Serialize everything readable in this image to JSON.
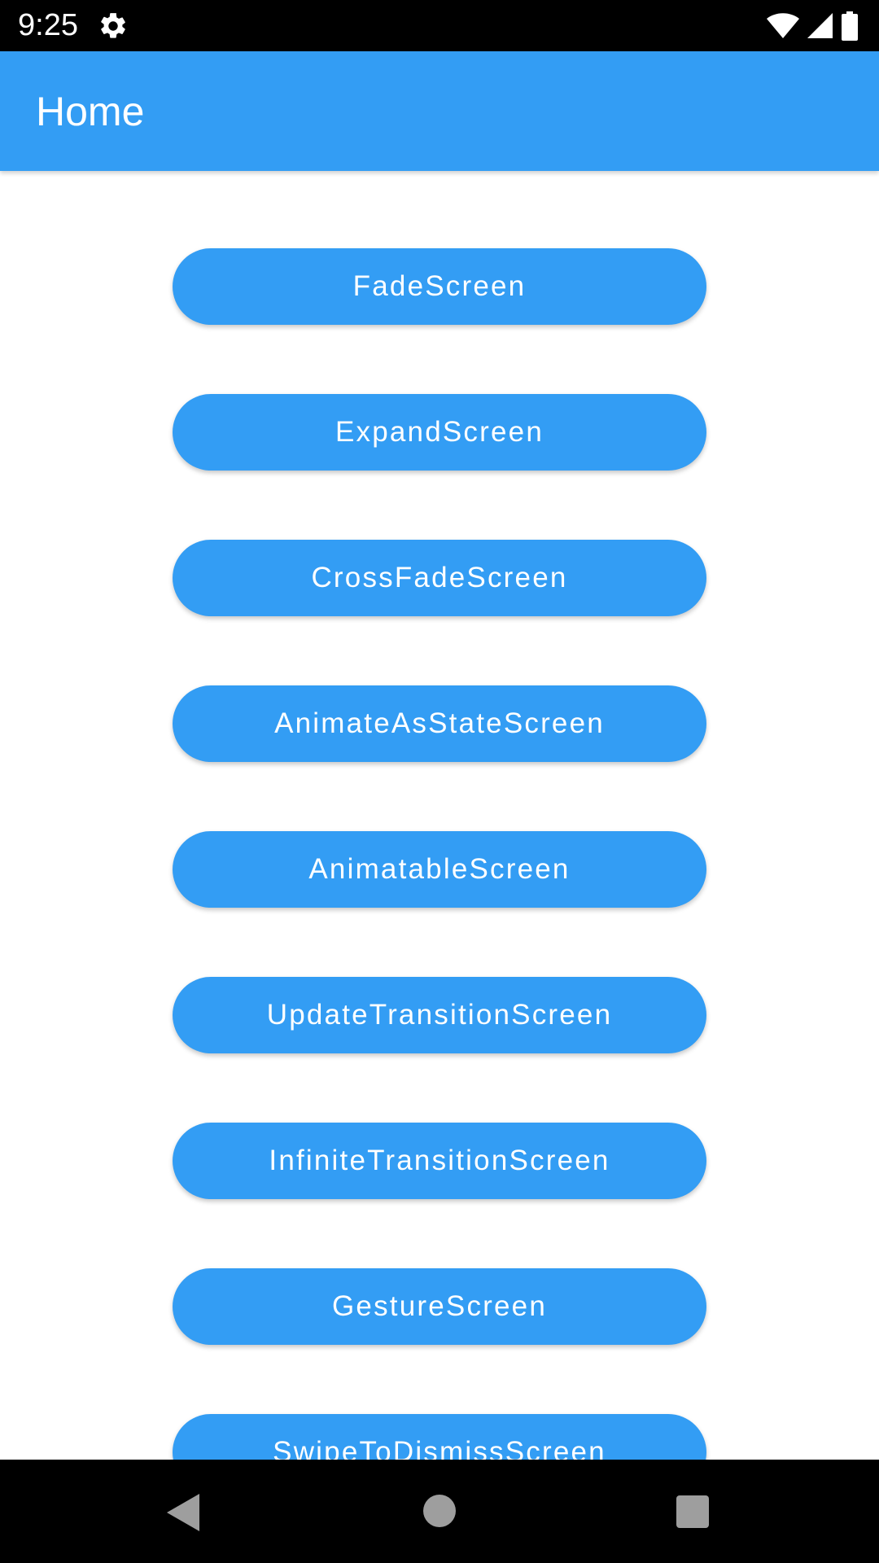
{
  "status_bar": {
    "time": "9:25",
    "icons": [
      "settings-gear-icon",
      "wifi-icon",
      "cellular-signal-icon",
      "battery-icon"
    ]
  },
  "app_bar": {
    "title": "Home"
  },
  "buttons": [
    {
      "label": "FadeScreen"
    },
    {
      "label": "ExpandScreen"
    },
    {
      "label": "CrossFadeScreen"
    },
    {
      "label": "AnimateAsStateScreen"
    },
    {
      "label": "AnimatableScreen"
    },
    {
      "label": "UpdateTransitionScreen"
    },
    {
      "label": "InfiniteTransitionScreen"
    },
    {
      "label": "GestureScreen"
    },
    {
      "label": "SwipeToDismissScreen"
    }
  ],
  "nav_bar": {
    "icons": [
      "back-icon",
      "home-icon",
      "recents-icon"
    ]
  },
  "colors": {
    "primary": "#339df4",
    "on_primary": "#ffffff",
    "system_bar": "#000000",
    "nav_icon": "#9e9e9e"
  }
}
